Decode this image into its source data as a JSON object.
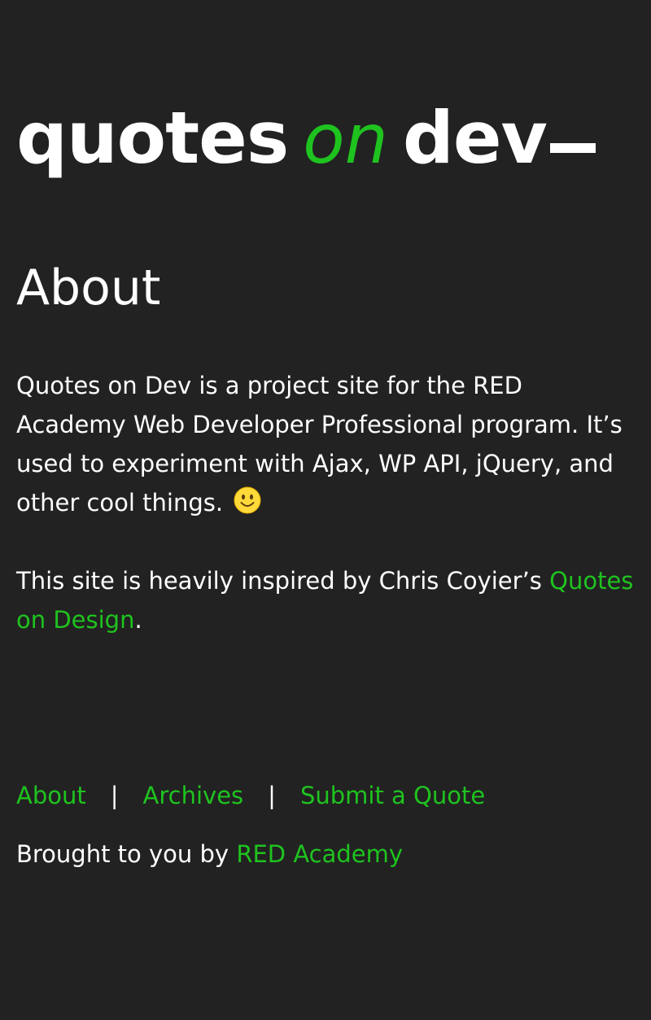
{
  "colors": {
    "background": "#222222",
    "text": "#ffffff",
    "accent": "#1fc31f"
  },
  "logo": {
    "word1": "quotes",
    "word2": "on",
    "word3": "dev"
  },
  "main": {
    "title": "About",
    "paragraph1": "Quotes on Dev is a project site for the RED Academy Web Developer Professional program. It’s used to experiment with Ajax, WP API, jQuery, and other cool things.",
    "paragraph1_emoji": "smiley-face-icon",
    "paragraph2_prefix": "This site is heavily inspired by Chris Coyier’s ",
    "paragraph2_link": "Quotes on Design",
    "paragraph2_suffix": "."
  },
  "footer": {
    "nav": [
      {
        "label": "About"
      },
      {
        "label": "Archives"
      },
      {
        "label": "Submit a Quote"
      }
    ],
    "separator": "|",
    "credit_prefix": "Brought to you by ",
    "credit_link": "RED Academy"
  }
}
